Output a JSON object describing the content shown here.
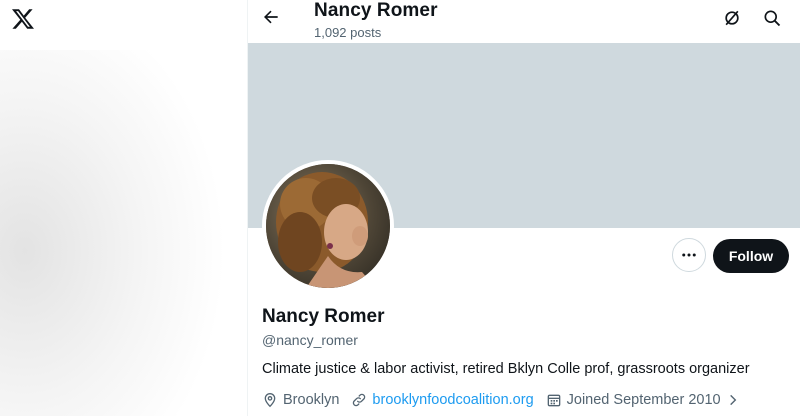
{
  "header": {
    "title": "Nancy Romer",
    "post_count": "1,092 posts"
  },
  "profile": {
    "display_name": "Nancy Romer",
    "handle": "@nancy_romer",
    "bio": "Climate justice & labor activist, retired Bklyn Colle prof, grassroots organizer",
    "location": "Brooklyn",
    "website": "brooklynfoodcoalition.org",
    "joined": "Joined September 2010"
  },
  "actions": {
    "follow_label": "Follow"
  },
  "icons": {
    "logo": "x-logo-icon",
    "back": "arrow-left-icon",
    "grok": "grok-icon",
    "search": "search-icon",
    "more": "more-horizontal-icon",
    "location": "location-pin-icon",
    "link": "link-icon",
    "calendar": "calendar-icon",
    "chevron": "chevron-right-icon"
  },
  "colors": {
    "banner": "#cfd9de",
    "follow_bg": "#0f1419",
    "link": "#1d9bf0",
    "secondary_text": "#536471"
  }
}
